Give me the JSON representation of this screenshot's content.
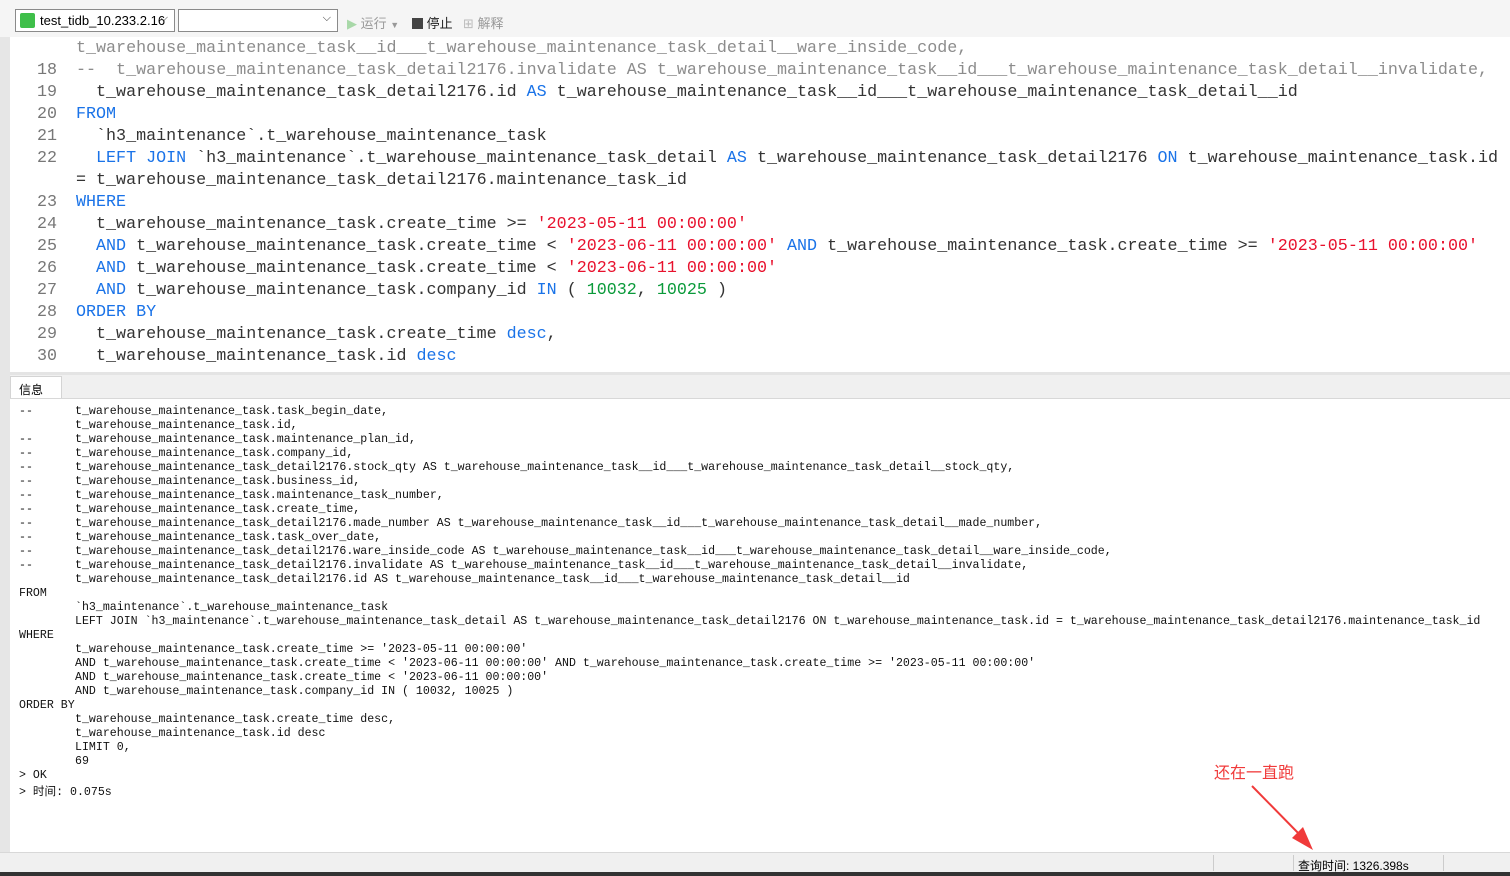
{
  "toolbar": {
    "connection": "test_tidb_10.233.2.16",
    "database": "",
    "run_label": "运行",
    "stop_label": "停止",
    "explain_label": "解释"
  },
  "editor": {
    "lines": [
      {
        "num": "",
        "segs": [
          [
            "cm",
            "t_warehouse_maintenance_task__id___t_warehouse_maintenance_task_detail__ware_inside_code,"
          ]
        ]
      },
      {
        "num": "18",
        "segs": [
          [
            "cm",
            "--  t_warehouse_maintenance_task_detail2176.invalidate AS t_warehouse_maintenance_task__id___t_warehouse_maintenance_task_detail__invalidate,"
          ]
        ]
      },
      {
        "num": "19",
        "segs": [
          [
            "",
            "  t_warehouse_maintenance_task_detail2176.id "
          ],
          [
            "kw",
            "AS"
          ],
          [
            "",
            " t_warehouse_maintenance_task__id___t_warehouse_maintenance_task_detail__id"
          ]
        ]
      },
      {
        "num": "20",
        "segs": [
          [
            "kw",
            "FROM"
          ]
        ]
      },
      {
        "num": "21",
        "segs": [
          [
            "",
            "  `h3_maintenance`.t_warehouse_maintenance_task"
          ]
        ]
      },
      {
        "num": "22",
        "segs": [
          [
            "kw",
            "  LEFT JOIN"
          ],
          [
            "",
            " `h3_maintenance`.t_warehouse_maintenance_task_detail "
          ],
          [
            "kw",
            "AS"
          ],
          [
            "",
            " t_warehouse_maintenance_task_detail2176 "
          ],
          [
            "kw",
            "ON"
          ],
          [
            "",
            " t_warehouse_maintenance_task.id"
          ]
        ]
      },
      {
        "num": "",
        "segs": [
          [
            "",
            "= t_warehouse_maintenance_task_detail2176.maintenance_task_id"
          ]
        ]
      },
      {
        "num": "23",
        "segs": [
          [
            "kw",
            "WHERE"
          ]
        ]
      },
      {
        "num": "24",
        "segs": [
          [
            "",
            "  t_warehouse_maintenance_task.create_time >= "
          ],
          [
            "str",
            "'2023-05-11 00:00:00'"
          ]
        ]
      },
      {
        "num": "25",
        "segs": [
          [
            "kw",
            "  AND"
          ],
          [
            "",
            " t_warehouse_maintenance_task.create_time < "
          ],
          [
            "str",
            "'2023-06-11 00:00:00'"
          ],
          [
            "kw",
            " AND"
          ],
          [
            "",
            " t_warehouse_maintenance_task.create_time >= "
          ],
          [
            "str",
            "'2023-05-11 00:00:00'"
          ]
        ]
      },
      {
        "num": "26",
        "segs": [
          [
            "kw",
            "  AND"
          ],
          [
            "",
            " t_warehouse_maintenance_task.create_time < "
          ],
          [
            "str",
            "'2023-06-11 00:00:00'"
          ]
        ]
      },
      {
        "num": "27",
        "segs": [
          [
            "kw",
            "  AND"
          ],
          [
            "",
            " t_warehouse_maintenance_task.company_id "
          ],
          [
            "kw",
            "IN"
          ],
          [
            "",
            " ( "
          ],
          [
            "num2",
            "10032"
          ],
          [
            "",
            ", "
          ],
          [
            "num2",
            "10025"
          ],
          [
            "",
            " )"
          ]
        ]
      },
      {
        "num": "28",
        "segs": [
          [
            "kw",
            "ORDER BY"
          ]
        ]
      },
      {
        "num": "29",
        "segs": [
          [
            "",
            "  t_warehouse_maintenance_task.create_time "
          ],
          [
            "kw",
            "desc"
          ],
          [
            "",
            ","
          ]
        ]
      },
      {
        "num": "30",
        "segs": [
          [
            "",
            "  t_warehouse_maintenance_task.id "
          ],
          [
            "kw",
            "desc"
          ]
        ]
      }
    ]
  },
  "output": {
    "tab_label": "信息",
    "lines": [
      [
        "--",
        "t_warehouse_maintenance_task.task_begin_date,"
      ],
      [
        "",
        "t_warehouse_maintenance_task.id,"
      ],
      [
        "--",
        "t_warehouse_maintenance_task.maintenance_plan_id,"
      ],
      [
        "--",
        "t_warehouse_maintenance_task.company_id,"
      ],
      [
        "--",
        "t_warehouse_maintenance_task_detail2176.stock_qty AS t_warehouse_maintenance_task__id___t_warehouse_maintenance_task_detail__stock_qty,"
      ],
      [
        "--",
        "t_warehouse_maintenance_task.business_id,"
      ],
      [
        "--",
        "t_warehouse_maintenance_task.maintenance_task_number,"
      ],
      [
        "--",
        "t_warehouse_maintenance_task.create_time,"
      ],
      [
        "--",
        "t_warehouse_maintenance_task_detail2176.made_number AS t_warehouse_maintenance_task__id___t_warehouse_maintenance_task_detail__made_number,"
      ],
      [
        "--",
        "t_warehouse_maintenance_task.task_over_date,"
      ],
      [
        "--",
        "t_warehouse_maintenance_task_detail2176.ware_inside_code AS t_warehouse_maintenance_task__id___t_warehouse_maintenance_task_detail__ware_inside_code,"
      ],
      [
        "--",
        "t_warehouse_maintenance_task_detail2176.invalidate AS t_warehouse_maintenance_task__id___t_warehouse_maintenance_task_detail__invalidate,"
      ],
      [
        "",
        "t_warehouse_maintenance_task_detail2176.id AS t_warehouse_maintenance_task__id___t_warehouse_maintenance_task_detail__id"
      ],
      [
        "FROM",
        ""
      ],
      [
        "",
        "`h3_maintenance`.t_warehouse_maintenance_task"
      ],
      [
        "",
        "LEFT JOIN `h3_maintenance`.t_warehouse_maintenance_task_detail AS t_warehouse_maintenance_task_detail2176 ON t_warehouse_maintenance_task.id = t_warehouse_maintenance_task_detail2176.maintenance_task_id"
      ],
      [
        "WHERE",
        ""
      ],
      [
        "",
        "t_warehouse_maintenance_task.create_time >= '2023-05-11 00:00:00'"
      ],
      [
        "",
        "AND t_warehouse_maintenance_task.create_time < '2023-06-11 00:00:00' AND t_warehouse_maintenance_task.create_time >= '2023-05-11 00:00:00'"
      ],
      [
        "",
        "AND t_warehouse_maintenance_task.create_time < '2023-06-11 00:00:00'"
      ],
      [
        "",
        "AND t_warehouse_maintenance_task.company_id IN ( 10032, 10025 )"
      ],
      [
        "ORDER BY",
        ""
      ],
      [
        "",
        "t_warehouse_maintenance_task.create_time desc,"
      ],
      [
        "",
        "t_warehouse_maintenance_task.id desc"
      ],
      [
        "",
        "LIMIT 0,"
      ],
      [
        "",
        "69"
      ],
      [
        "> OK",
        ""
      ],
      [
        "> 时间: 0.075s",
        ""
      ]
    ]
  },
  "annotation": "还在一直跑",
  "status": {
    "query_time": "查询时间: 1326.398s"
  }
}
